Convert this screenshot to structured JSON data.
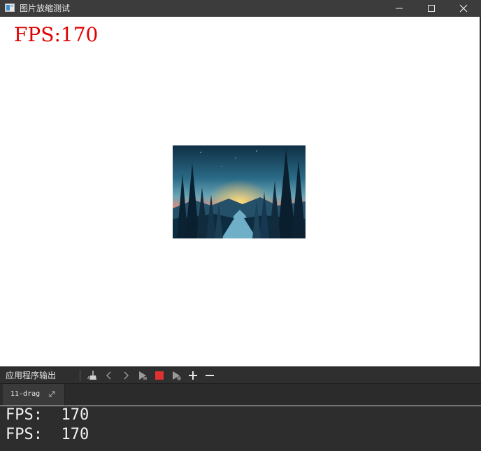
{
  "window": {
    "title": "图片放缩测试",
    "icon": "window-icon",
    "controls": {
      "minimize": "minimize-icon",
      "maximize": "maximize-icon",
      "close": "close-icon"
    }
  },
  "canvas": {
    "fps_overlay": "FPS:170",
    "fps_color": "#e00000",
    "image_subject": "night forest sunset landscape"
  },
  "output_panel": {
    "title": "应用程序输出",
    "toolbar_icons": [
      "clear-output-icon",
      "prev-icon",
      "next-icon",
      "run-icon",
      "stop-icon",
      "debug-run-icon",
      "zoom-in-icon",
      "zoom-out-icon"
    ],
    "stop_color": "#e03030",
    "tab": {
      "label": "11-drag"
    },
    "lines": [
      "FPS:  170",
      "FPS:  170"
    ]
  }
}
